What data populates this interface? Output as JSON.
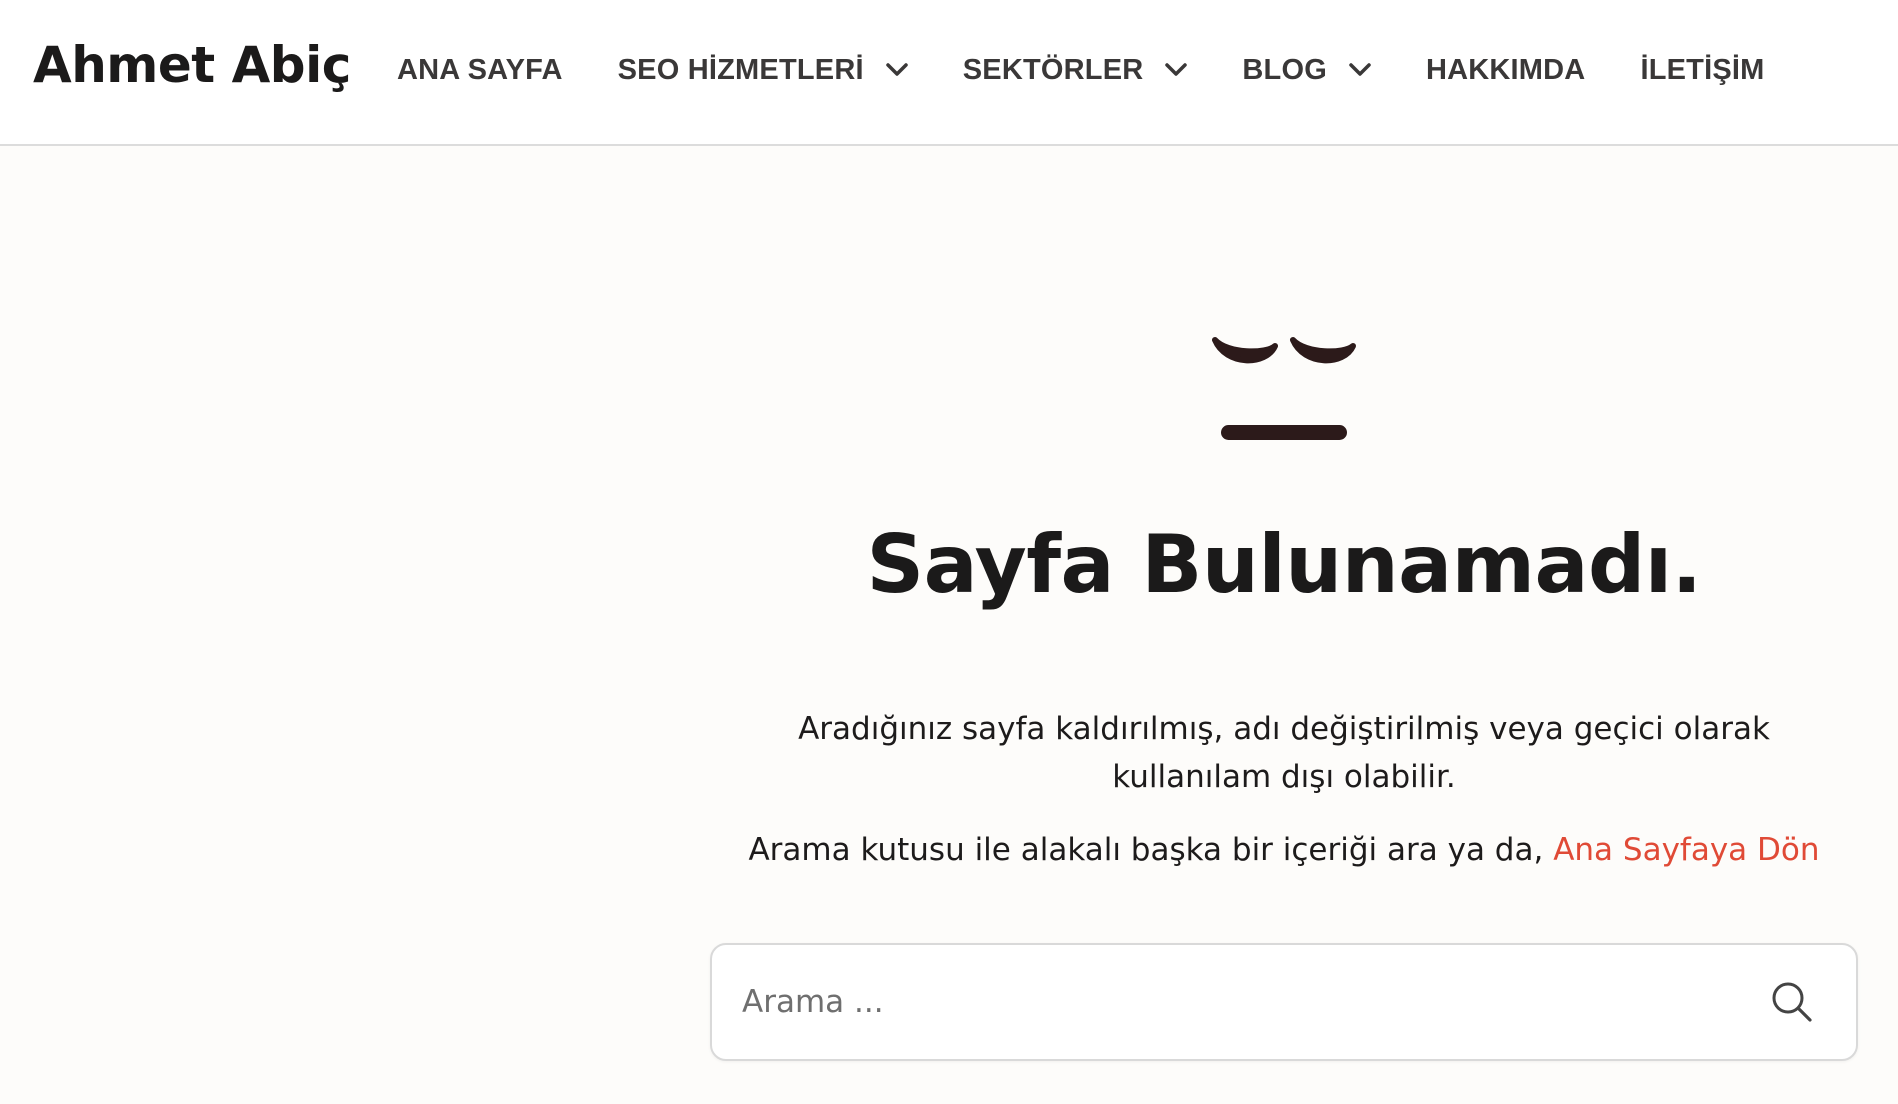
{
  "header": {
    "logo": "Ahmet Abiç",
    "nav": [
      {
        "label": "ANA SAYFA",
        "dropdown": false
      },
      {
        "label": "SEO HİZMETLERİ",
        "dropdown": true
      },
      {
        "label": "SEKTÖRLER",
        "dropdown": true
      },
      {
        "label": "BLOG",
        "dropdown": true
      },
      {
        "label": "HAKKIMDA",
        "dropdown": false
      },
      {
        "label": "İLETİŞİM",
        "dropdown": false
      }
    ]
  },
  "main": {
    "icon": "sad-face-icon",
    "title": "Sayfa Bulunamadı.",
    "description": "Aradığınız sayfa kaldırılmış, adı değiştirilmiş veya geçici olarak kullanılam dışı olabilir.",
    "search_hint": "Arama kutusu ile alakalı başka bir içeriği ara ya da,",
    "home_link": "Ana Sayfaya Dön",
    "search": {
      "placeholder": "Arama ...",
      "value": ""
    }
  },
  "colors": {
    "background": "#fdfcfa",
    "link": "#e04a36",
    "face": "#2c1a1a",
    "text": "#1d1b1b"
  }
}
